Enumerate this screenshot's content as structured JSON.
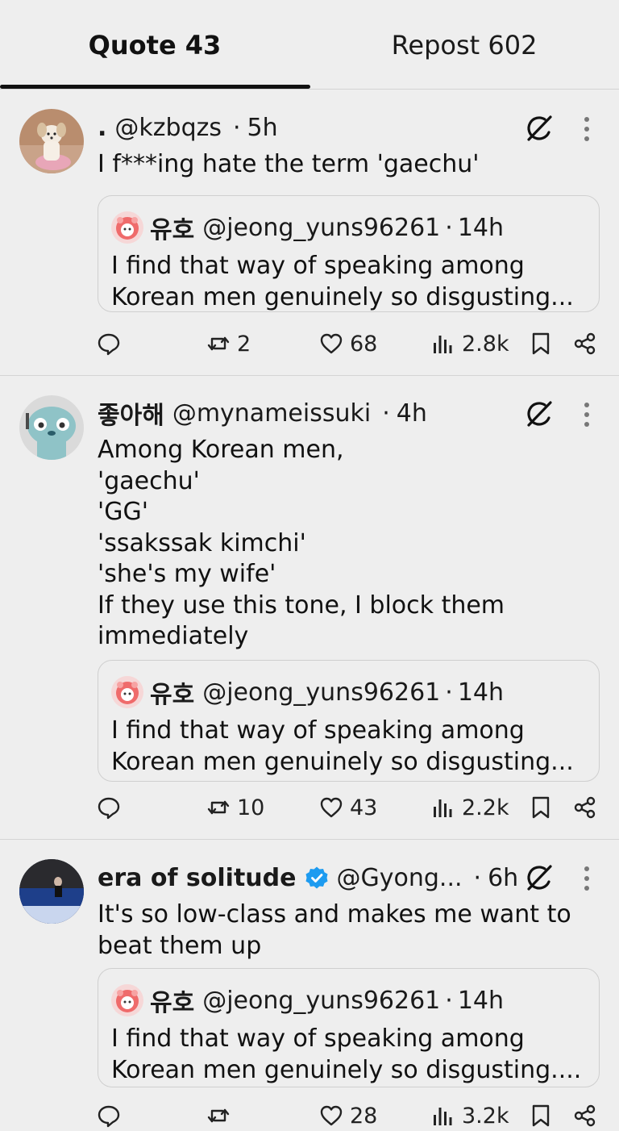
{
  "tabs": [
    {
      "label": "Quote 43",
      "active": true
    },
    {
      "label": "Repost 602",
      "active": false
    }
  ],
  "colors": {
    "verified": "#1d9bf0",
    "text": "#111111",
    "background": "#eeeeee",
    "divider": "#d4d4d4"
  },
  "quoted_post": {
    "name": "유호",
    "handle": "@jeong_yuns96261",
    "time": "14h"
  },
  "posts": [
    {
      "name": "",
      "prefix": ".",
      "handle": "@kzbqzs",
      "time": "5h",
      "verified": false,
      "text": "I f***ing hate the term 'gaechu'",
      "quote_text": "I find that way of speaking among\nKorean men genuinely so disgusting...",
      "replies": "",
      "reposts": "2",
      "likes": "68",
      "views": "2.8k"
    },
    {
      "name": "좋아해",
      "handle": "@mynameissuki",
      "time": "4h",
      "verified": false,
      "text": "Among Korean men,\n'gaechu'\n'GG'\n'ssakssak kimchi'\n'she's my wife'\nIf they use this tone, I block them\nimmediately",
      "quote_text": "I find that way of speaking among\nKorean men genuinely so disgusting...",
      "replies": "",
      "reposts": "10",
      "likes": "43",
      "views": "2.2k"
    },
    {
      "name": "era of solitude",
      "handle": "@Gyong...",
      "time": "6h",
      "verified": true,
      "text": "It's so low-class and makes me want to\nbeat them up",
      "quote_text": "I find that way of speaking among\nKorean men genuinely so disgusting....",
      "replies": "",
      "reposts": "",
      "likes": "28",
      "views": "3.2k"
    }
  ],
  "icons": {
    "reply": "speech-bubble-icon",
    "repost": "repost-arrows-icon",
    "like": "heart-icon",
    "views": "bar-chart-icon",
    "bookmark": "bookmark-icon",
    "share": "share-icon",
    "grok": "grok-slash-circle-icon",
    "more": "vertical-dots-icon"
  }
}
